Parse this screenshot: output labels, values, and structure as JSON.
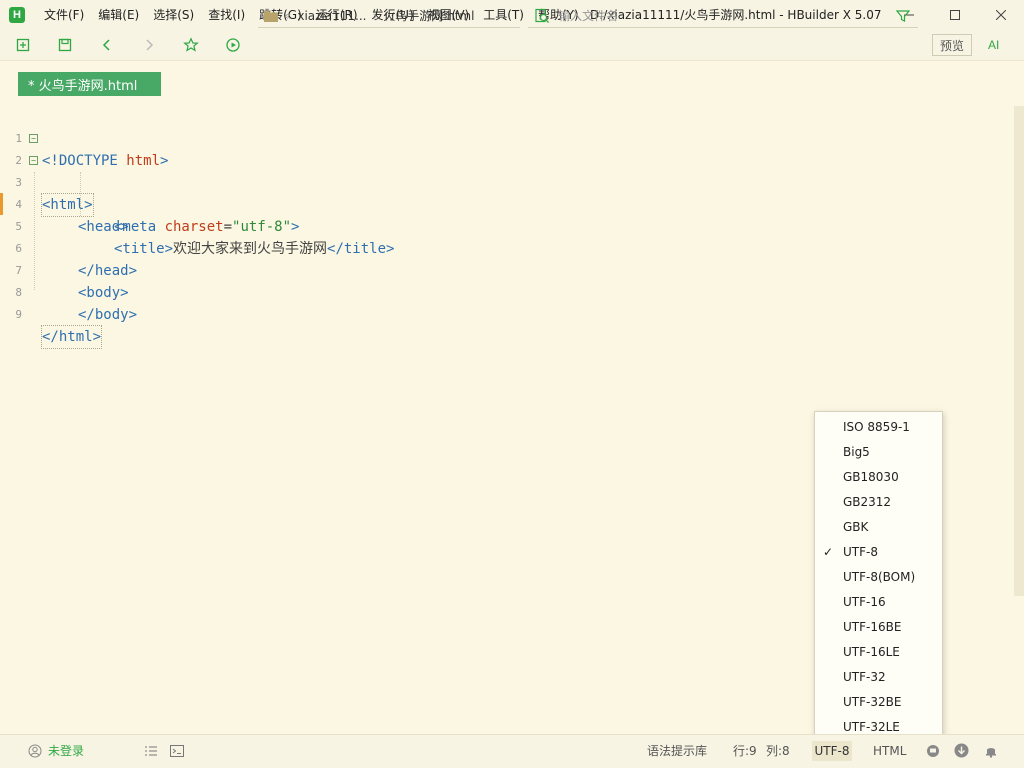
{
  "app": {
    "logo": "H",
    "window_title": "D:/xiazia11111/火鸟手游网.html - HBuilder X 5.07"
  },
  "menu": [
    {
      "label": "文件(F)"
    },
    {
      "label": "编辑(E)"
    },
    {
      "label": "选择(S)"
    },
    {
      "label": "查找(I)"
    },
    {
      "label": "跳转(G)"
    },
    {
      "label": "运行(R)"
    },
    {
      "label": "发行(U)"
    },
    {
      "label": "视图(V)"
    },
    {
      "label": "工具(T)"
    },
    {
      "label": "帮助(Y)"
    }
  ],
  "toolbar": {
    "breadcrumb": {
      "prefix": "«",
      "folder": "xiazia111...",
      "separator": "›",
      "file": "火鸟手游网.html"
    },
    "search_placeholder": "输入文件名",
    "preview_label": "预览",
    "ai_label": "AI"
  },
  "tab": {
    "label": "* 火鸟手游网.html"
  },
  "editor": {
    "lines": [
      {
        "n": "1"
      },
      {
        "n": "2"
      },
      {
        "n": "3"
      },
      {
        "n": "4"
      },
      {
        "n": "5"
      },
      {
        "n": "6"
      },
      {
        "n": "7"
      },
      {
        "n": "8"
      },
      {
        "n": "9"
      }
    ],
    "code": {
      "l1_a": "<!DOCTYPE ",
      "l1_b": "html",
      "l1_c": ">",
      "l2": "<html>",
      "l3": "<head>",
      "l4_a": "<meta ",
      "l4_b": "charset",
      "l4_c": "=",
      "l4_d": "\"utf-8\"",
      "l4_e": ">",
      "l5_a": "<title>",
      "l5_b": "欢迎大家来到火鸟手游网",
      "l5_c": "</title>",
      "l6": "</head>",
      "l7": "<body>",
      "l8": "</body>",
      "l9": "</html>"
    }
  },
  "encoding_menu": {
    "items": [
      {
        "label": "ISO 8859-1"
      },
      {
        "label": "Big5"
      },
      {
        "label": "GB18030"
      },
      {
        "label": "GB2312"
      },
      {
        "label": "GBK"
      },
      {
        "label": "UTF-8",
        "checked": true
      },
      {
        "label": "UTF-8(BOM)"
      },
      {
        "label": "UTF-16"
      },
      {
        "label": "UTF-16BE"
      },
      {
        "label": "UTF-16LE"
      },
      {
        "label": "UTF-32"
      },
      {
        "label": "UTF-32BE"
      },
      {
        "label": "UTF-32LE"
      }
    ],
    "check_mark": "✓"
  },
  "status": {
    "login": "未登录",
    "syntax_hint": "语法提示库",
    "row": "行:9",
    "col": "列:8",
    "encoding": "UTF-8",
    "language": "HTML"
  },
  "colors": {
    "accent": "#2fa844",
    "tab_bg": "#48a865",
    "editor_bg": "#fbf7e2",
    "tag": "#2f6fb0",
    "attr": "#c03c1c",
    "string": "#2e8b3a"
  }
}
